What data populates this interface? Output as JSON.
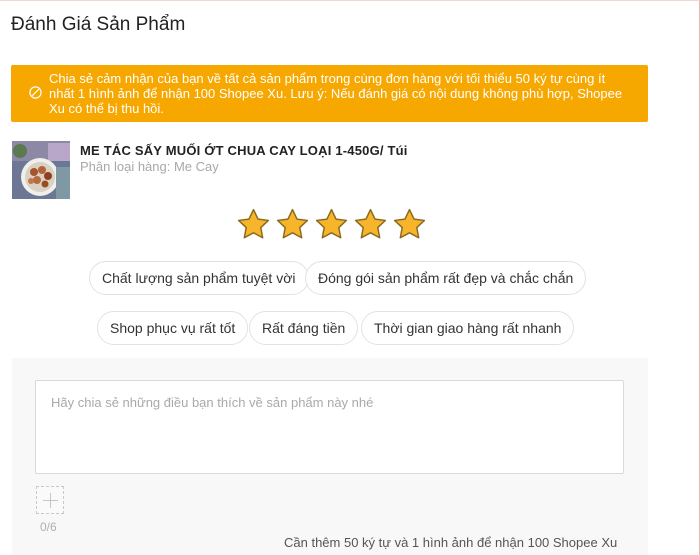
{
  "page": {
    "title": "Đánh Giá Sản Phẩm"
  },
  "banner": {
    "text": "Chia sẻ cảm nhận của bạn về tất cả sản phẩm trong cùng đơn hàng với tối thiểu 50 ký tự cùng ít nhất 1 hình ảnh để nhận 100 Shopee Xu. Lưu ý: Nếu đánh giá có nội dung không phù hợp, Shopee Xu có thể bị thu hồi.",
    "icon": "coin-icon",
    "background_color": "#f6a700"
  },
  "product": {
    "name": "ME TÁC SẤY MUỐI ỚT CHUA CAY LOẠI 1-450G/ Túi",
    "variant": "Phân loại hàng: Me Cay"
  },
  "rating": {
    "stars_selected": 5,
    "stars_total": 5,
    "star_color": "#f7b52c"
  },
  "tags": [
    "Chất lượng sản phẩm tuyệt vời",
    "Đóng gói sản phẩm rất đẹp và chắc chắn",
    "Shop phục vụ rất tốt",
    "Rất đáng tiền",
    "Thời gian giao hàng rất nhanh"
  ],
  "review": {
    "placeholder": "Hãy chia sẻ những điều bạn thích về sản phẩm này nhé",
    "upload_count": "0/6",
    "hint": "Cần thêm 50 ký tự và 1 hình ảnh để nhận 100 Shopee Xu"
  }
}
